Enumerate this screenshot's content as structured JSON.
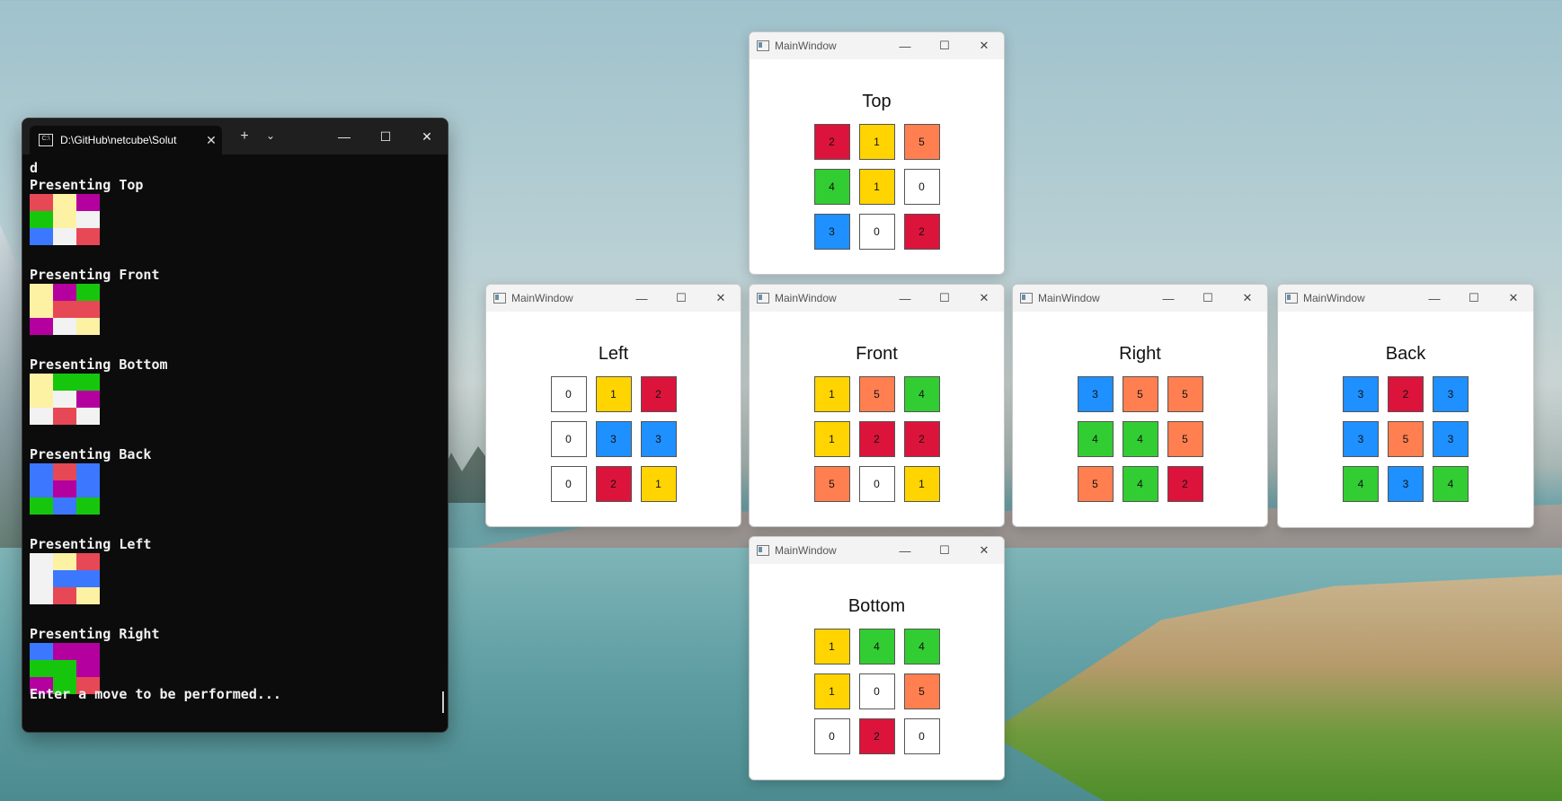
{
  "palette": {
    "0": "#ffffff",
    "1": "#ffd400",
    "2": "#dc143c",
    "3": "#1e90ff",
    "4": "#32cd32",
    "5": "#ff7f50"
  },
  "term_palette": {
    "W": "#f2f2f2",
    "Y": "#fdf1a4",
    "R": "#e74856",
    "B": "#3b78ff",
    "G": "#16c60c",
    "M": "#b4009e"
  },
  "terminal": {
    "tab_title": "D:\\GitHub\\netcube\\Solut",
    "tab_icon": "C:\\",
    "new_tab": "+",
    "dropdown": "⌄",
    "minimize": "—",
    "maximize": "☐",
    "close": "✕",
    "first_line": "d",
    "sections": [
      {
        "label": "Presenting Top",
        "cells": [
          "R",
          "Y",
          "M",
          "G",
          "Y",
          "W",
          "B",
          "W",
          "R"
        ]
      },
      {
        "label": "Presenting Front",
        "cells": [
          "Y",
          "M",
          "G",
          "Y",
          "R",
          "R",
          "M",
          "W",
          "Y"
        ]
      },
      {
        "label": "Presenting Bottom",
        "cells": [
          "Y",
          "G",
          "G",
          "Y",
          "W",
          "M",
          "W",
          "R",
          "W"
        ]
      },
      {
        "label": "Presenting Back",
        "cells": [
          "B",
          "R",
          "B",
          "B",
          "M",
          "B",
          "G",
          "B",
          "G"
        ]
      },
      {
        "label": "Presenting Left",
        "cells": [
          "W",
          "Y",
          "R",
          "W",
          "B",
          "B",
          "W",
          "R",
          "Y"
        ]
      },
      {
        "label": "Presenting Right",
        "cells": [
          "B",
          "M",
          "M",
          "G",
          "G",
          "M",
          "M",
          "G",
          "R"
        ]
      }
    ],
    "prompt": "Enter a move to be performed..."
  },
  "window_title": "MainWindow",
  "window_controls": {
    "minimize": "—",
    "maximize": "☐",
    "close": "✕"
  },
  "faces": [
    {
      "id": "top",
      "title": "Top",
      "cells": [
        2,
        1,
        5,
        4,
        1,
        0,
        3,
        0,
        2
      ]
    },
    {
      "id": "left",
      "title": "Left",
      "cells": [
        0,
        1,
        2,
        0,
        3,
        3,
        0,
        2,
        1
      ]
    },
    {
      "id": "front",
      "title": "Front",
      "cells": [
        1,
        5,
        4,
        1,
        2,
        2,
        5,
        0,
        1
      ]
    },
    {
      "id": "right",
      "title": "Right",
      "cells": [
        3,
        5,
        5,
        4,
        4,
        5,
        5,
        4,
        2
      ]
    },
    {
      "id": "back",
      "title": "Back",
      "cells": [
        3,
        2,
        3,
        3,
        5,
        3,
        4,
        3,
        4
      ]
    },
    {
      "id": "bottom",
      "title": "Bottom",
      "cells": [
        1,
        4,
        4,
        1,
        0,
        5,
        0,
        2,
        0
      ]
    }
  ]
}
